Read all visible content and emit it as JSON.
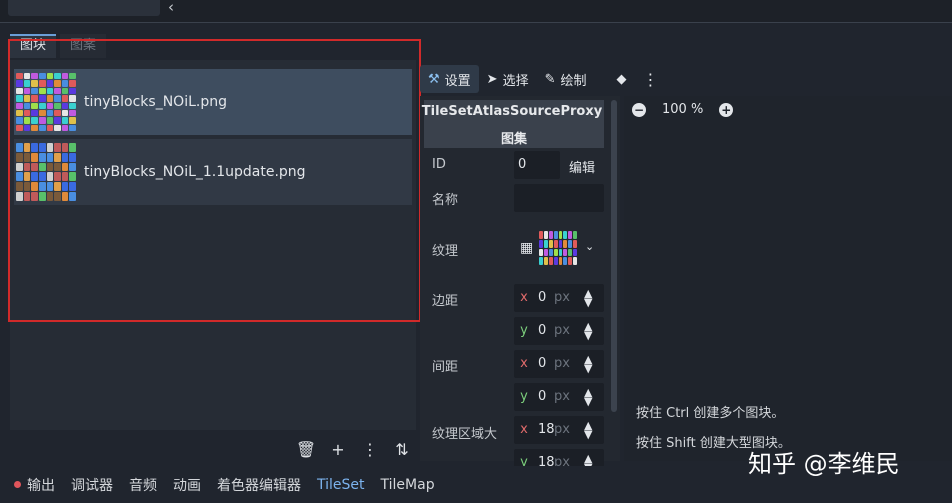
{
  "tabs": {
    "tiles": "图块",
    "patterns": "图案"
  },
  "sources": [
    {
      "name": "tinyBlocks_NOiL.png"
    },
    {
      "name": "tinyBlocks_NOiL_1.1update.png"
    }
  ],
  "bottom_tools": {
    "delete": "🗑",
    "add": "+",
    "menu": "⋮",
    "sort": "⇅"
  },
  "statusbar": {
    "output": "输出",
    "debugger": "调试器",
    "audio": "音频",
    "animation": "动画",
    "shader_editor": "着色器编辑器",
    "tileset": "TileSet",
    "tilemap": "TileMap"
  },
  "toolbar": {
    "setup": "设置",
    "select": "选择",
    "paint": "绘制"
  },
  "inspector": {
    "title": "TileSetAtlasSourceProxy",
    "subtitle": "图集",
    "id_label": "ID",
    "id_value": "0",
    "edit_label": "编辑",
    "name_label": "名称",
    "texture_label": "纹理",
    "margins_label": "边距",
    "separation_label": "间距",
    "region_size_label": "纹理区域大",
    "margin_x": "0",
    "margin_y": "0",
    "sep_x": "0",
    "sep_y": "0",
    "region_x": "18",
    "region_y": "18",
    "unit": "px",
    "x": "x",
    "y": "y"
  },
  "zoom": {
    "value": "100 %"
  },
  "hints": {
    "ctrl": "按住 Ctrl 创建多个图块。",
    "shift": "按住 Shift 创建大型图块。"
  },
  "watermark": "知乎 @李维民",
  "colors": {
    "accent": "#7cb3ee",
    "highlight_box": "#d12a2a"
  }
}
